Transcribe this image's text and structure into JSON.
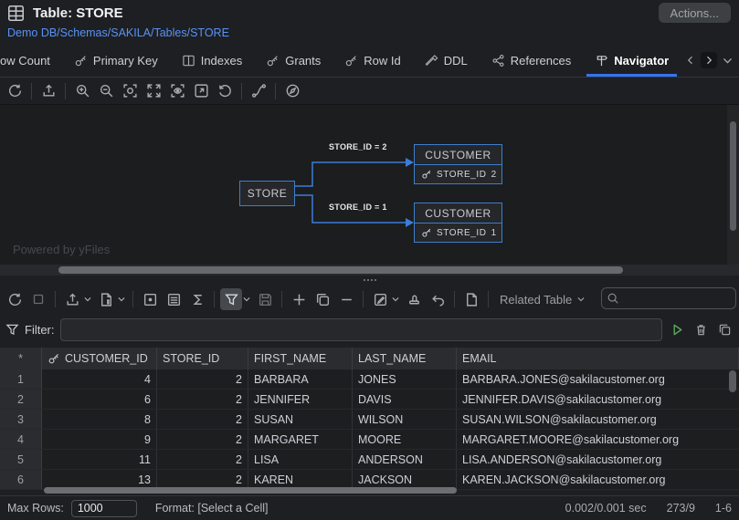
{
  "window": {
    "title": "Table: STORE"
  },
  "header": {
    "actions_button": "Actions...",
    "breadcrumb": "Demo DB/Schemas/SAKILA/Tables/STORE"
  },
  "tabs": {
    "items": [
      {
        "label": "ow Count"
      },
      {
        "label": "Primary Key"
      },
      {
        "label": "Indexes"
      },
      {
        "label": "Grants"
      },
      {
        "label": "Row Id"
      },
      {
        "label": "DDL"
      },
      {
        "label": "References"
      },
      {
        "label": "Navigator"
      }
    ],
    "active": "Navigator"
  },
  "icons": {
    "toolbar1": [
      "refresh",
      "export",
      "zoom-in",
      "zoom-out",
      "zoom-selection",
      "fit-content",
      "overview",
      "open-in-window",
      "reset-view",
      "route-edges",
      "navigate"
    ],
    "toolbar2": [
      "refresh",
      "stop",
      "export",
      "file-format",
      "cell-view",
      "row-view",
      "aggregate-sigma",
      "filter",
      "save-edits",
      "add-row",
      "duplicate-row",
      "delete-row",
      "edit-cell",
      "commit-stamp",
      "undo",
      "new-window"
    ],
    "filter_actions": [
      "run-filter",
      "clear-filter",
      "copy-filter"
    ]
  },
  "diagram": {
    "source": {
      "title": "STORE"
    },
    "targets": [
      {
        "title": "CUSTOMER",
        "field": "STORE_ID",
        "value": "2",
        "edge_label": "STORE_ID = 2"
      },
      {
        "title": "CUSTOMER",
        "field": "STORE_ID",
        "value": "1",
        "edge_label": "STORE_ID = 1"
      }
    ],
    "watermark": "Powered by yFiles"
  },
  "toolbar2": {
    "related_table": "Related Table"
  },
  "filter_row": {
    "label": "Filter:",
    "value": ""
  },
  "search": {
    "value": ""
  },
  "grid": {
    "gutter_header": "*",
    "columns": [
      "CUSTOMER_ID",
      "STORE_ID",
      "FIRST_NAME",
      "LAST_NAME",
      "EMAIL"
    ],
    "rows": [
      [
        "1",
        "4",
        "2",
        "BARBARA",
        "JONES",
        "BARBARA.JONES@sakilacustomer.org"
      ],
      [
        "2",
        "6",
        "2",
        "JENNIFER",
        "DAVIS",
        "JENNIFER.DAVIS@sakilacustomer.org"
      ],
      [
        "3",
        "8",
        "2",
        "SUSAN",
        "WILSON",
        "SUSAN.WILSON@sakilacustomer.org"
      ],
      [
        "4",
        "9",
        "2",
        "MARGARET",
        "MOORE",
        "MARGARET.MOORE@sakilacustomer.org"
      ],
      [
        "5",
        "11",
        "2",
        "LISA",
        "ANDERSON",
        "LISA.ANDERSON@sakilacustomer.org"
      ],
      [
        "6",
        "13",
        "2",
        "KAREN",
        "JACKSON",
        "KAREN.JACKSON@sakilacustomer.org"
      ]
    ]
  },
  "status_bar": {
    "max_rows_label": "Max Rows:",
    "max_rows_value": "1000",
    "format_label": "Format: [Select a Cell]",
    "time": "0.002/0.001 sec",
    "rows_cols": "273/9",
    "range": "1-6"
  },
  "colors": {
    "accent_blue": "#3574f0",
    "link_blue": "#5793f6",
    "diagram_node_border": "#3f7ecb",
    "diagram_edge": "#3b7dd8",
    "run_green": "#5aa85f",
    "background": "#1e1f22"
  }
}
